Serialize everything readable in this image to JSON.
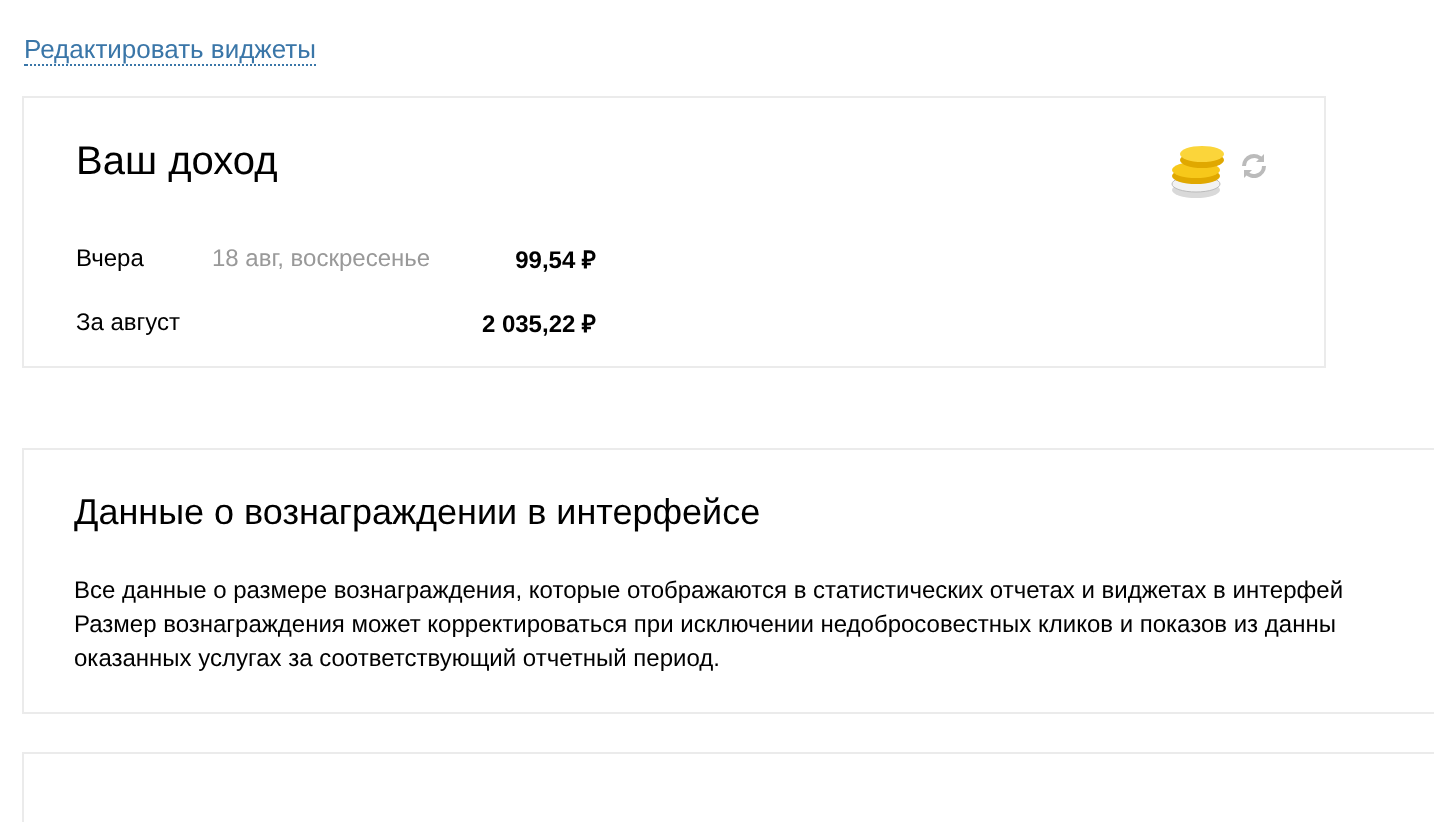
{
  "edit_link": "Редактировать виджеты",
  "income_widget": {
    "title": "Ваш доход",
    "rows": [
      {
        "label": "Вчера",
        "date": "18 авг, воскресенье",
        "amount": "99,54 ₽"
      },
      {
        "label": "За август",
        "amount": "2 035,22 ₽"
      }
    ]
  },
  "reward_info": {
    "title": "Данные о вознаграждении в интерфейсе",
    "lines": [
      "Все данные о размере вознаграждения, которые отображаются в статистических отчетах и виджетах в интерфей",
      "Размер вознаграждения может корректироваться при исключении недобросовестных кликов и показов из данны",
      "оказанных услугах за соответствующий отчетный период."
    ]
  }
}
